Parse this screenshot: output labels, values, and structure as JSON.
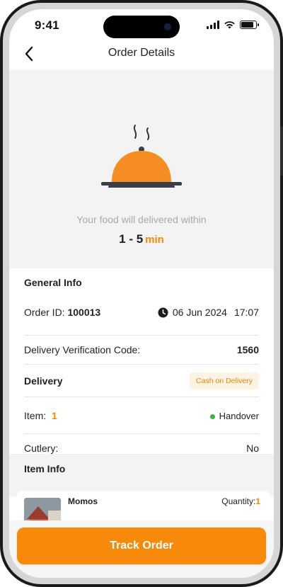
{
  "status_bar": {
    "time": "9:41"
  },
  "header": {
    "title": "Order Details",
    "back_icon": "chevron-left-icon"
  },
  "hero": {
    "message": "Your food will delivered within",
    "eta_range": "1 - 5",
    "eta_unit": "min",
    "icon": "food-cloche-icon",
    "accent_color": "#f58a07"
  },
  "general_info": {
    "heading": "General Info",
    "order_id_label": "Order ID:",
    "order_id": "100013",
    "date": "06 Jun 2024",
    "time": "17:07",
    "verification_label": "Delivery Verification Code:",
    "verification_code": "1560",
    "delivery_label": "Delivery",
    "payment_badge": "Cash on Delivery",
    "item_label": "Item:",
    "item_count": "1",
    "status": "Handover",
    "cutlery_label": "Cutlery:",
    "cutlery_value": "No"
  },
  "item_info": {
    "heading": "Item Info",
    "items": [
      {
        "name": "Momos",
        "quantity_label": "Quantity:",
        "quantity": "1"
      }
    ]
  },
  "actions": {
    "track_order": "Track Order"
  }
}
